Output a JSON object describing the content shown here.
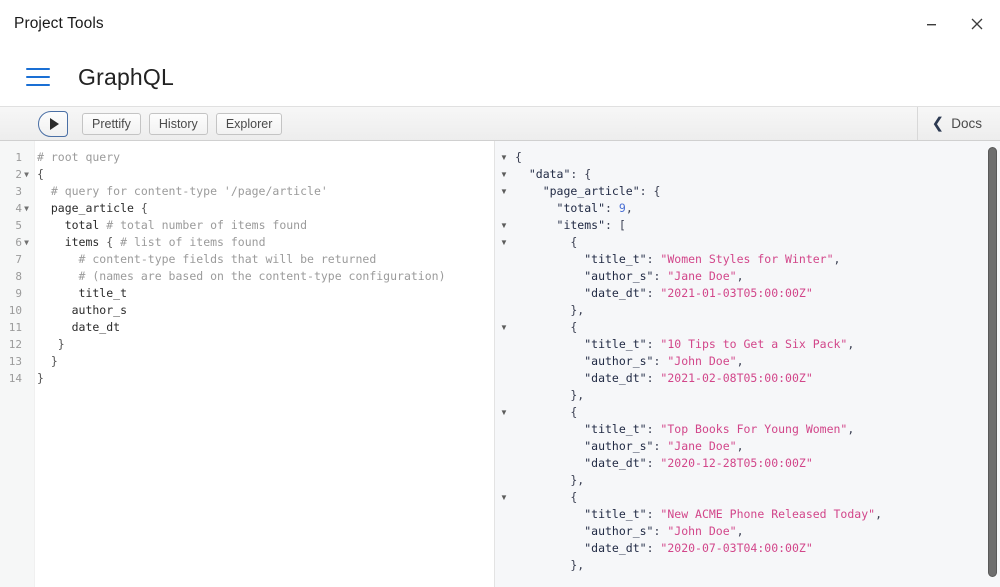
{
  "window": {
    "title": "Project Tools",
    "controls": [
      {
        "name": "minimize",
        "glyph": "–"
      },
      {
        "name": "close",
        "glyph": "✕"
      }
    ]
  },
  "app_header": {
    "menu_icon": "hamburger-icon",
    "title": "GraphQL",
    "accent_color": "#1a6fd4"
  },
  "toolbar": {
    "execute_label": "",
    "execute_icon": "play-icon",
    "buttons": [
      {
        "label": "Prettify"
      },
      {
        "label": "History"
      },
      {
        "label": "Explorer"
      }
    ],
    "docs": {
      "label": "Docs",
      "icon": "chevron-left-icon"
    }
  },
  "query_editor": {
    "lines": [
      {
        "num": "1",
        "fold": false,
        "tokens": [
          {
            "t": "# root query",
            "c": "cm-comment"
          }
        ]
      },
      {
        "num": "2",
        "fold": true,
        "tokens": [
          {
            "t": "{",
            "c": "cm-punct"
          }
        ]
      },
      {
        "num": "3",
        "fold": false,
        "tokens": [
          {
            "t": "  # query for content-type '/page/article'",
            "c": "cm-comment"
          }
        ]
      },
      {
        "num": "4",
        "fold": true,
        "tokens": [
          {
            "t": "  page_article ",
            "c": "cm-field"
          },
          {
            "t": "{",
            "c": "cm-punct"
          }
        ]
      },
      {
        "num": "5",
        "fold": false,
        "tokens": [
          {
            "t": "    total ",
            "c": "cm-field"
          },
          {
            "t": "# total number of items found",
            "c": "cm-comment"
          }
        ]
      },
      {
        "num": "6",
        "fold": true,
        "tokens": [
          {
            "t": "    items ",
            "c": "cm-field"
          },
          {
            "t": "{ ",
            "c": "cm-punct"
          },
          {
            "t": "# list of items found",
            "c": "cm-comment"
          }
        ]
      },
      {
        "num": "7",
        "fold": false,
        "tokens": [
          {
            "t": "      # content-type fields that will be returned",
            "c": "cm-comment"
          }
        ]
      },
      {
        "num": "8",
        "fold": false,
        "tokens": [
          {
            "t": "      # (names are based on the content-type configuration)",
            "c": "cm-comment"
          }
        ]
      },
      {
        "num": "9",
        "fold": false,
        "tokens": [
          {
            "t": "      title_t",
            "c": "cm-field"
          }
        ]
      },
      {
        "num": "10",
        "fold": false,
        "tokens": [
          {
            "t": "     author_s",
            "c": "cm-field"
          }
        ]
      },
      {
        "num": "11",
        "fold": false,
        "tokens": [
          {
            "t": "     date_dt",
            "c": "cm-field"
          }
        ]
      },
      {
        "num": "12",
        "fold": false,
        "tokens": [
          {
            "t": "   }",
            "c": "cm-punct"
          }
        ]
      },
      {
        "num": "13",
        "fold": false,
        "tokens": [
          {
            "t": "  }",
            "c": "cm-punct"
          }
        ]
      },
      {
        "num": "14",
        "fold": false,
        "tokens": [
          {
            "t": "}",
            "c": "cm-punct"
          }
        ]
      }
    ]
  },
  "result_panel": {
    "lines": [
      {
        "fold": true,
        "tokens": [
          {
            "t": "{",
            "c": "j-punct"
          }
        ]
      },
      {
        "fold": true,
        "tokens": [
          {
            "t": "  \"data\"",
            "c": "j-key"
          },
          {
            "t": ": {",
            "c": "j-punct"
          }
        ]
      },
      {
        "fold": true,
        "tokens": [
          {
            "t": "    \"page_article\"",
            "c": "j-key"
          },
          {
            "t": ": {",
            "c": "j-punct"
          }
        ]
      },
      {
        "fold": false,
        "tokens": [
          {
            "t": "      \"total\"",
            "c": "j-key"
          },
          {
            "t": ": ",
            "c": "j-punct"
          },
          {
            "t": "9",
            "c": "j-num"
          },
          {
            "t": ",",
            "c": "j-punct"
          }
        ]
      },
      {
        "fold": true,
        "tokens": [
          {
            "t": "      \"items\"",
            "c": "j-key"
          },
          {
            "t": ": [",
            "c": "j-punct"
          }
        ]
      },
      {
        "fold": true,
        "tokens": [
          {
            "t": "        {",
            "c": "j-punct"
          }
        ]
      },
      {
        "fold": false,
        "tokens": [
          {
            "t": "          \"title_t\"",
            "c": "j-key"
          },
          {
            "t": ": ",
            "c": "j-punct"
          },
          {
            "t": "\"Women Styles for Winter\"",
            "c": "j-str"
          },
          {
            "t": ",",
            "c": "j-punct"
          }
        ]
      },
      {
        "fold": false,
        "tokens": [
          {
            "t": "          \"author_s\"",
            "c": "j-key"
          },
          {
            "t": ": ",
            "c": "j-punct"
          },
          {
            "t": "\"Jane Doe\"",
            "c": "j-str"
          },
          {
            "t": ",",
            "c": "j-punct"
          }
        ]
      },
      {
        "fold": false,
        "tokens": [
          {
            "t": "          \"date_dt\"",
            "c": "j-key"
          },
          {
            "t": ": ",
            "c": "j-punct"
          },
          {
            "t": "\"2021-01-03T05:00:00Z\"",
            "c": "j-str"
          }
        ]
      },
      {
        "fold": false,
        "tokens": [
          {
            "t": "        },",
            "c": "j-punct"
          }
        ]
      },
      {
        "fold": true,
        "tokens": [
          {
            "t": "        {",
            "c": "j-punct"
          }
        ]
      },
      {
        "fold": false,
        "tokens": [
          {
            "t": "          \"title_t\"",
            "c": "j-key"
          },
          {
            "t": ": ",
            "c": "j-punct"
          },
          {
            "t": "\"10 Tips to Get a Six Pack\"",
            "c": "j-str"
          },
          {
            "t": ",",
            "c": "j-punct"
          }
        ]
      },
      {
        "fold": false,
        "tokens": [
          {
            "t": "          \"author_s\"",
            "c": "j-key"
          },
          {
            "t": ": ",
            "c": "j-punct"
          },
          {
            "t": "\"John Doe\"",
            "c": "j-str"
          },
          {
            "t": ",",
            "c": "j-punct"
          }
        ]
      },
      {
        "fold": false,
        "tokens": [
          {
            "t": "          \"date_dt\"",
            "c": "j-key"
          },
          {
            "t": ": ",
            "c": "j-punct"
          },
          {
            "t": "\"2021-02-08T05:00:00Z\"",
            "c": "j-str"
          }
        ]
      },
      {
        "fold": false,
        "tokens": [
          {
            "t": "        },",
            "c": "j-punct"
          }
        ]
      },
      {
        "fold": true,
        "tokens": [
          {
            "t": "        {",
            "c": "j-punct"
          }
        ]
      },
      {
        "fold": false,
        "tokens": [
          {
            "t": "          \"title_t\"",
            "c": "j-key"
          },
          {
            "t": ": ",
            "c": "j-punct"
          },
          {
            "t": "\"Top Books For Young Women\"",
            "c": "j-str"
          },
          {
            "t": ",",
            "c": "j-punct"
          }
        ]
      },
      {
        "fold": false,
        "tokens": [
          {
            "t": "          \"author_s\"",
            "c": "j-key"
          },
          {
            "t": ": ",
            "c": "j-punct"
          },
          {
            "t": "\"Jane Doe\"",
            "c": "j-str"
          },
          {
            "t": ",",
            "c": "j-punct"
          }
        ]
      },
      {
        "fold": false,
        "tokens": [
          {
            "t": "          \"date_dt\"",
            "c": "j-key"
          },
          {
            "t": ": ",
            "c": "j-punct"
          },
          {
            "t": "\"2020-12-28T05:00:00Z\"",
            "c": "j-str"
          }
        ]
      },
      {
        "fold": false,
        "tokens": [
          {
            "t": "        },",
            "c": "j-punct"
          }
        ]
      },
      {
        "fold": true,
        "tokens": [
          {
            "t": "        {",
            "c": "j-punct"
          }
        ]
      },
      {
        "fold": false,
        "tokens": [
          {
            "t": "          \"title_t\"",
            "c": "j-key"
          },
          {
            "t": ": ",
            "c": "j-punct"
          },
          {
            "t": "\"New ACME Phone Released Today\"",
            "c": "j-str"
          },
          {
            "t": ",",
            "c": "j-punct"
          }
        ]
      },
      {
        "fold": false,
        "tokens": [
          {
            "t": "          \"author_s\"",
            "c": "j-key"
          },
          {
            "t": ": ",
            "c": "j-punct"
          },
          {
            "t": "\"John Doe\"",
            "c": "j-str"
          },
          {
            "t": ",",
            "c": "j-punct"
          }
        ]
      },
      {
        "fold": false,
        "tokens": [
          {
            "t": "          \"date_dt\"",
            "c": "j-key"
          },
          {
            "t": ": ",
            "c": "j-punct"
          },
          {
            "t": "\"2020-07-03T04:00:00Z\"",
            "c": "j-str"
          }
        ]
      },
      {
        "fold": false,
        "tokens": [
          {
            "t": "        },",
            "c": "j-punct"
          }
        ]
      }
    ],
    "result_data": {
      "data": {
        "page_article": {
          "total": 9,
          "items": [
            {
              "title_t": "Women Styles for Winter",
              "author_s": "Jane Doe",
              "date_dt": "2021-01-03T05:00:00Z"
            },
            {
              "title_t": "10 Tips to Get a Six Pack",
              "author_s": "John Doe",
              "date_dt": "2021-02-08T05:00:00Z"
            },
            {
              "title_t": "Top Books For Young Women",
              "author_s": "Jane Doe",
              "date_dt": "2020-12-28T05:00:00Z"
            },
            {
              "title_t": "New ACME Phone Released Today",
              "author_s": "John Doe",
              "date_dt": "2020-07-03T04:00:00Z"
            }
          ]
        }
      }
    }
  }
}
